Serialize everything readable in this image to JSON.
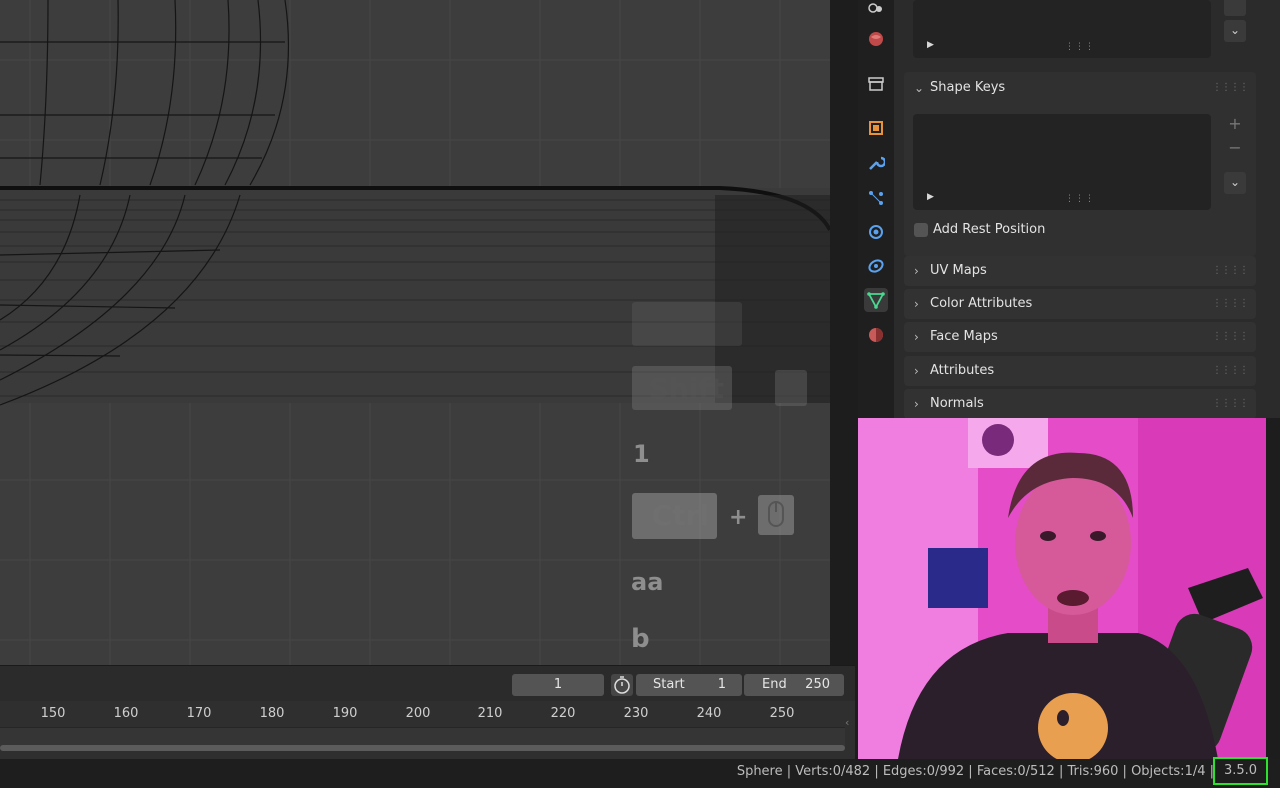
{
  "viewport": {
    "key_overlays": {
      "key1_text": "Shift",
      "number_1": "1",
      "ctrl_key": "Ctrl",
      "plus": "+",
      "aa": "aa",
      "b": "b"
    }
  },
  "timeline": {
    "current_frame": "1",
    "start_label": "Start",
    "start_value": "1",
    "end_label": "End",
    "end_value": "250",
    "ticks": [
      "150",
      "160",
      "170",
      "180",
      "190",
      "200",
      "210",
      "220",
      "230",
      "240",
      "250"
    ]
  },
  "properties": {
    "shape_keys": {
      "label": "Shape Keys",
      "add_rest_position": "Add Rest Position"
    },
    "panels": [
      {
        "label": "UV Maps"
      },
      {
        "label": "Color Attributes"
      },
      {
        "label": "Face Maps"
      },
      {
        "label": "Attributes"
      },
      {
        "label": "Normals"
      }
    ]
  },
  "statusbar": {
    "stats": "Sphere | Verts:0/482 | Edges:0/992 | Faces:0/512 | Tris:960 | Objects:1/4 |",
    "version": "3.5.0"
  },
  "colors": {
    "accent_green_highlight": "#2fe02f",
    "active_tab_green": "#4ad991",
    "webcam_pink": "#e846c9"
  }
}
